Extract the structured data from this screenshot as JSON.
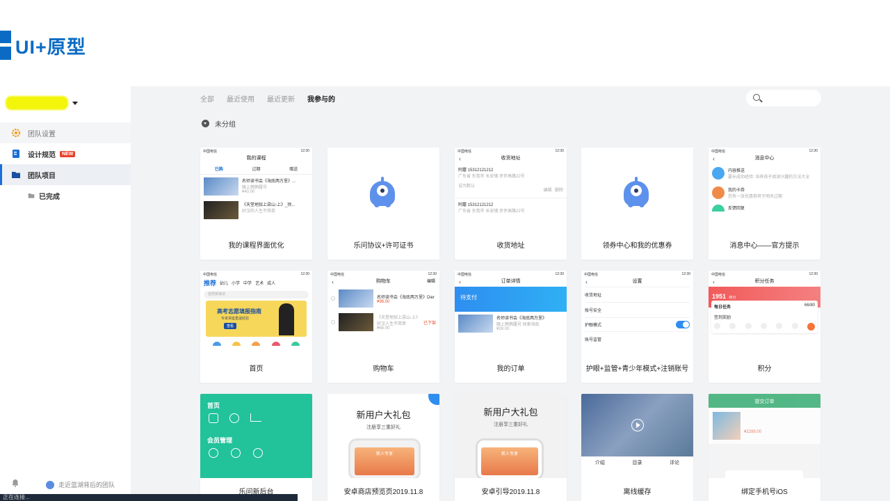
{
  "slide": {
    "title": "UI+原型"
  },
  "sidebar": {
    "items": [
      {
        "label": "团队设置"
      },
      {
        "label": "设计规范",
        "badge": "NEW"
      },
      {
        "label": "团队项目"
      },
      {
        "label": "已完成"
      }
    ],
    "recent": "走近蓝湖背后的团队"
  },
  "status": "正在连接...",
  "tabs": [
    "全部",
    "最近使用",
    "最近更新",
    "我参与的"
  ],
  "group": "未分组",
  "phone": {
    "carrier": "中国电信",
    "time": "12:30"
  },
  "cards": [
    {
      "label": "我的课程界面优化"
    },
    {
      "label": "乐问协议+许可证书"
    },
    {
      "label": "收货地址"
    },
    {
      "label": "领券中心和我的优惠券"
    },
    {
      "label": "消息中心——官方提示"
    },
    {
      "label": "首页"
    },
    {
      "label": "购物车"
    },
    {
      "label": "我的订单"
    },
    {
      "label": "护眼+监管+青少年模式+注销账号"
    },
    {
      "label": "积分"
    },
    {
      "label": "乐问新后台"
    },
    {
      "label": "安卓商店预览页2019.11.8"
    },
    {
      "label": "安卓引导2019.11.8"
    },
    {
      "label": "离线缓存"
    },
    {
      "label": "绑定手机号iOS"
    }
  ],
  "t_course": {
    "title": "我的课程",
    "tabs": [
      "已购",
      "过期",
      "赠送"
    ],
    "book1": "名师读书会《海底两万里》...",
    "book1_sub": "随上鹊鹊履号",
    "book1_price": "¥40.00",
    "book2": "《天堂地狱上梁山-上》_徐...",
    "book2_sub": "好汉的人生不简单"
  },
  "t_address": {
    "title": "收货地址",
    "name": "阿蘑  15312121212",
    "addr": "广东省 东莞市 长安镇 步步高路22号",
    "default": "设为默认",
    "edit": "编辑",
    "del": "删除"
  },
  "t_msg": {
    "title": "消息中心",
    "m1": "内容推送",
    "m1_sub": "要长成功经验: 培养孩子阅读兴趣的方法大全",
    "m2": "我的卡券",
    "m2_sub": "您有一张优惠券将于明天过期",
    "m3": "反馈回复"
  },
  "t_home": {
    "brand": "推荐",
    "tabs": [
      "幼儿",
      "小学",
      "中学",
      "艺术",
      "成人"
    ],
    "search": "自然拼读法",
    "banner": "高考志愿填报指南",
    "banner_sub": "专家讲座重温经验",
    "banner_btn": "查看"
  },
  "t_cart": {
    "title": "购物车",
    "edit": "编辑",
    "i1": "名师读书会《海底两万里》Dier",
    "i1_price": "¥98.00",
    "i2": "《天堂地狱上梁山-上》好汉人生不简单",
    "i2_price": "¥68.00",
    "tag": "已下架"
  },
  "t_order": {
    "title": "订单详情",
    "status": "待支付",
    "item": "名师读书会《海底两万里》",
    "item_sub": "随上鹊鹊履号 探索海底",
    "price": "¥28.00"
  },
  "t_settings": {
    "title": "设置",
    "rows": [
      "收货地址",
      "账号安全",
      "护眼模式",
      "账号监管"
    ]
  },
  "t_points": {
    "title": "积分任务",
    "points": "1951",
    "unit": "积分",
    "daily": "每日任务",
    "progress": "66/80",
    "checkin": "签到奖励"
  },
  "t_admin": {
    "s1": "首页",
    "s2": "会员管理"
  },
  "t_gift": {
    "title": "新用户大礼包",
    "sub": "注册享三重好礼",
    "screen": "新人专享"
  },
  "t_video": {
    "tabs": [
      "介绍",
      "目录",
      "评论"
    ]
  },
  "t_bind": {
    "title": "提交订单",
    "price": "¥2299.00"
  },
  "colors": {
    "brand": "#0b6bc4",
    "accent": "#1a6fd6",
    "teal": "#22c29b",
    "red": "#e84a2a"
  }
}
